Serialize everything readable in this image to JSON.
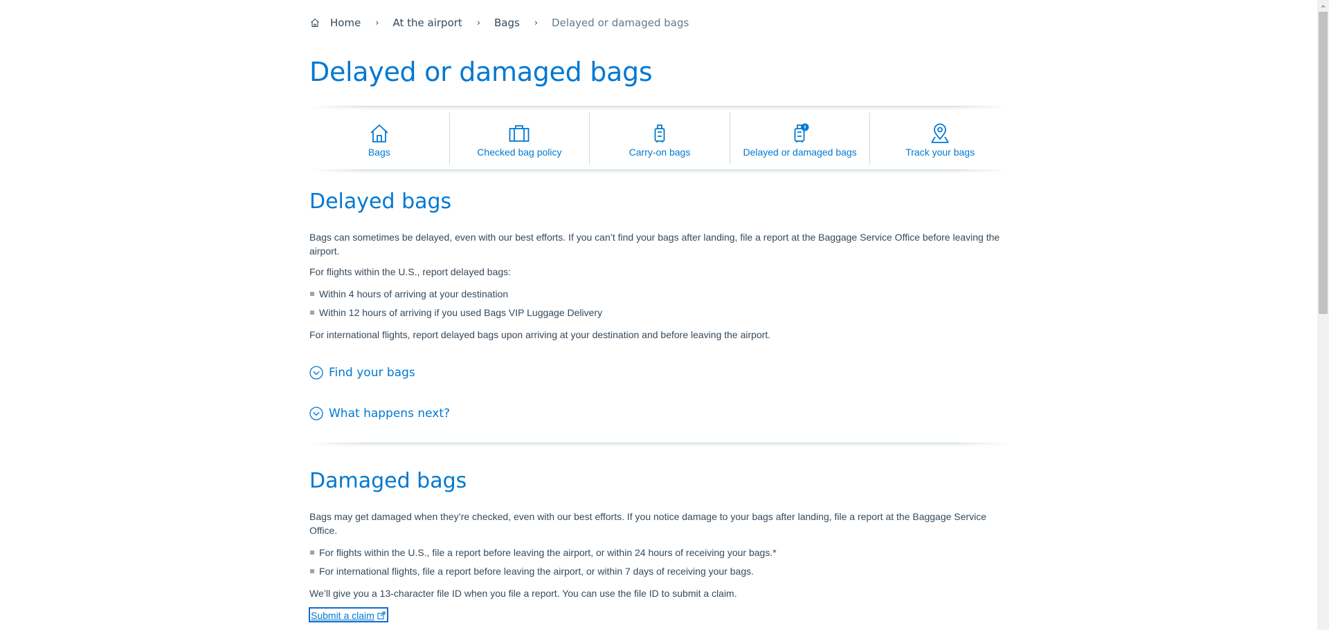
{
  "breadcrumb": {
    "items": [
      "Home",
      "At the airport",
      "Bags"
    ],
    "current": "Delayed or damaged bags",
    "separator": "›"
  },
  "page": {
    "title": "Delayed or damaged bags"
  },
  "tabs": [
    {
      "label": "Bags",
      "icon": "home-icon"
    },
    {
      "label": "Checked bag policy",
      "icon": "suitcase-icon"
    },
    {
      "label": "Carry-on bags",
      "icon": "carry-on-icon"
    },
    {
      "label": "Delayed or damaged bags",
      "icon": "bag-alert-icon"
    },
    {
      "label": "Track your bags",
      "icon": "location-pin-icon"
    }
  ],
  "delayed": {
    "title": "Delayed bags",
    "intro": "Bags can sometimes be delayed, even with our best efforts. If you can’t find your bags after landing, file a report at the Baggage Service Office before leaving the airport.",
    "domestic_lead": "For flights within the U.S., report delayed bags:",
    "bullets": [
      "Within 4 hours of arriving at your destination",
      "Within 12 hours of arriving if you used Bags VIP Luggage Delivery"
    ],
    "international": "For international flights, report delayed bags upon arriving at your destination and before leaving the airport.",
    "accordions": [
      "Find your bags",
      "What happens next?"
    ]
  },
  "damaged": {
    "title": "Damaged bags",
    "intro": "Bags may get damaged when they’re checked, even with our best efforts. If you notice damage to your bags after landing, file a report at the Baggage Service Office.",
    "bullets": [
      "For flights within the U.S., file a report before leaving the airport, or within 24 hours of receiving your bags.*",
      "For international flights, file a report before leaving the airport, or within 7 days of receiving your bags."
    ],
    "file_id_note": "We’ll give you a 13-character file ID when you file a report. You can use the file ID to submit a claim.",
    "claim_link": "Submit a claim"
  },
  "colors": {
    "accent": "#0078d2",
    "text": "#36495a",
    "muted": "#627a88"
  }
}
